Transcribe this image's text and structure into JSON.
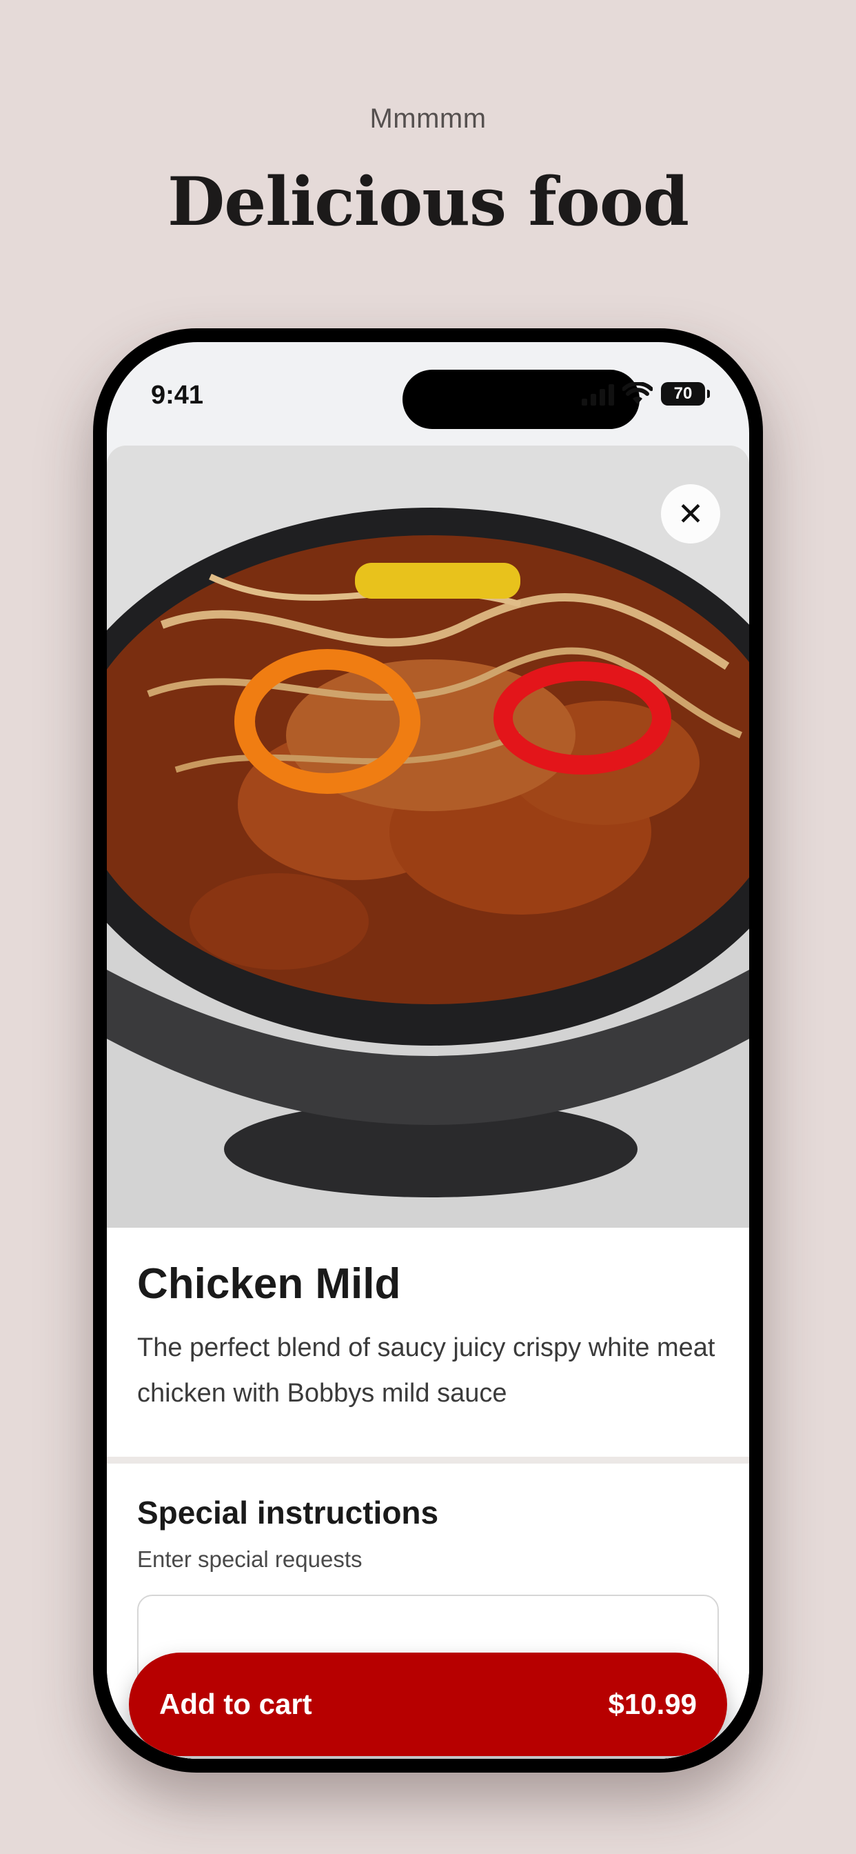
{
  "hero": {
    "eyebrow": "Mmmmm",
    "headline": "Delicious food"
  },
  "status_bar": {
    "time": "9:41",
    "battery": "70",
    "icons": [
      "signal-icon",
      "wifi-icon",
      "battery-icon"
    ]
  },
  "item": {
    "image_alt": "Chicken rice bowl with saucy crispy chicken, crispy onions and sliced peppers",
    "close_icon": "close-icon",
    "name": "Chicken Mild",
    "description": "The perfect blend of saucy juicy crispy white meat chicken with Bobbys mild sauce"
  },
  "special_instructions": {
    "title": "Special instructions",
    "subtitle": "Enter special requests",
    "value": ""
  },
  "cart": {
    "label": "Add to cart",
    "price": "$10.99"
  },
  "colors": {
    "background": "#e5dad8",
    "accent": "#b70000"
  }
}
